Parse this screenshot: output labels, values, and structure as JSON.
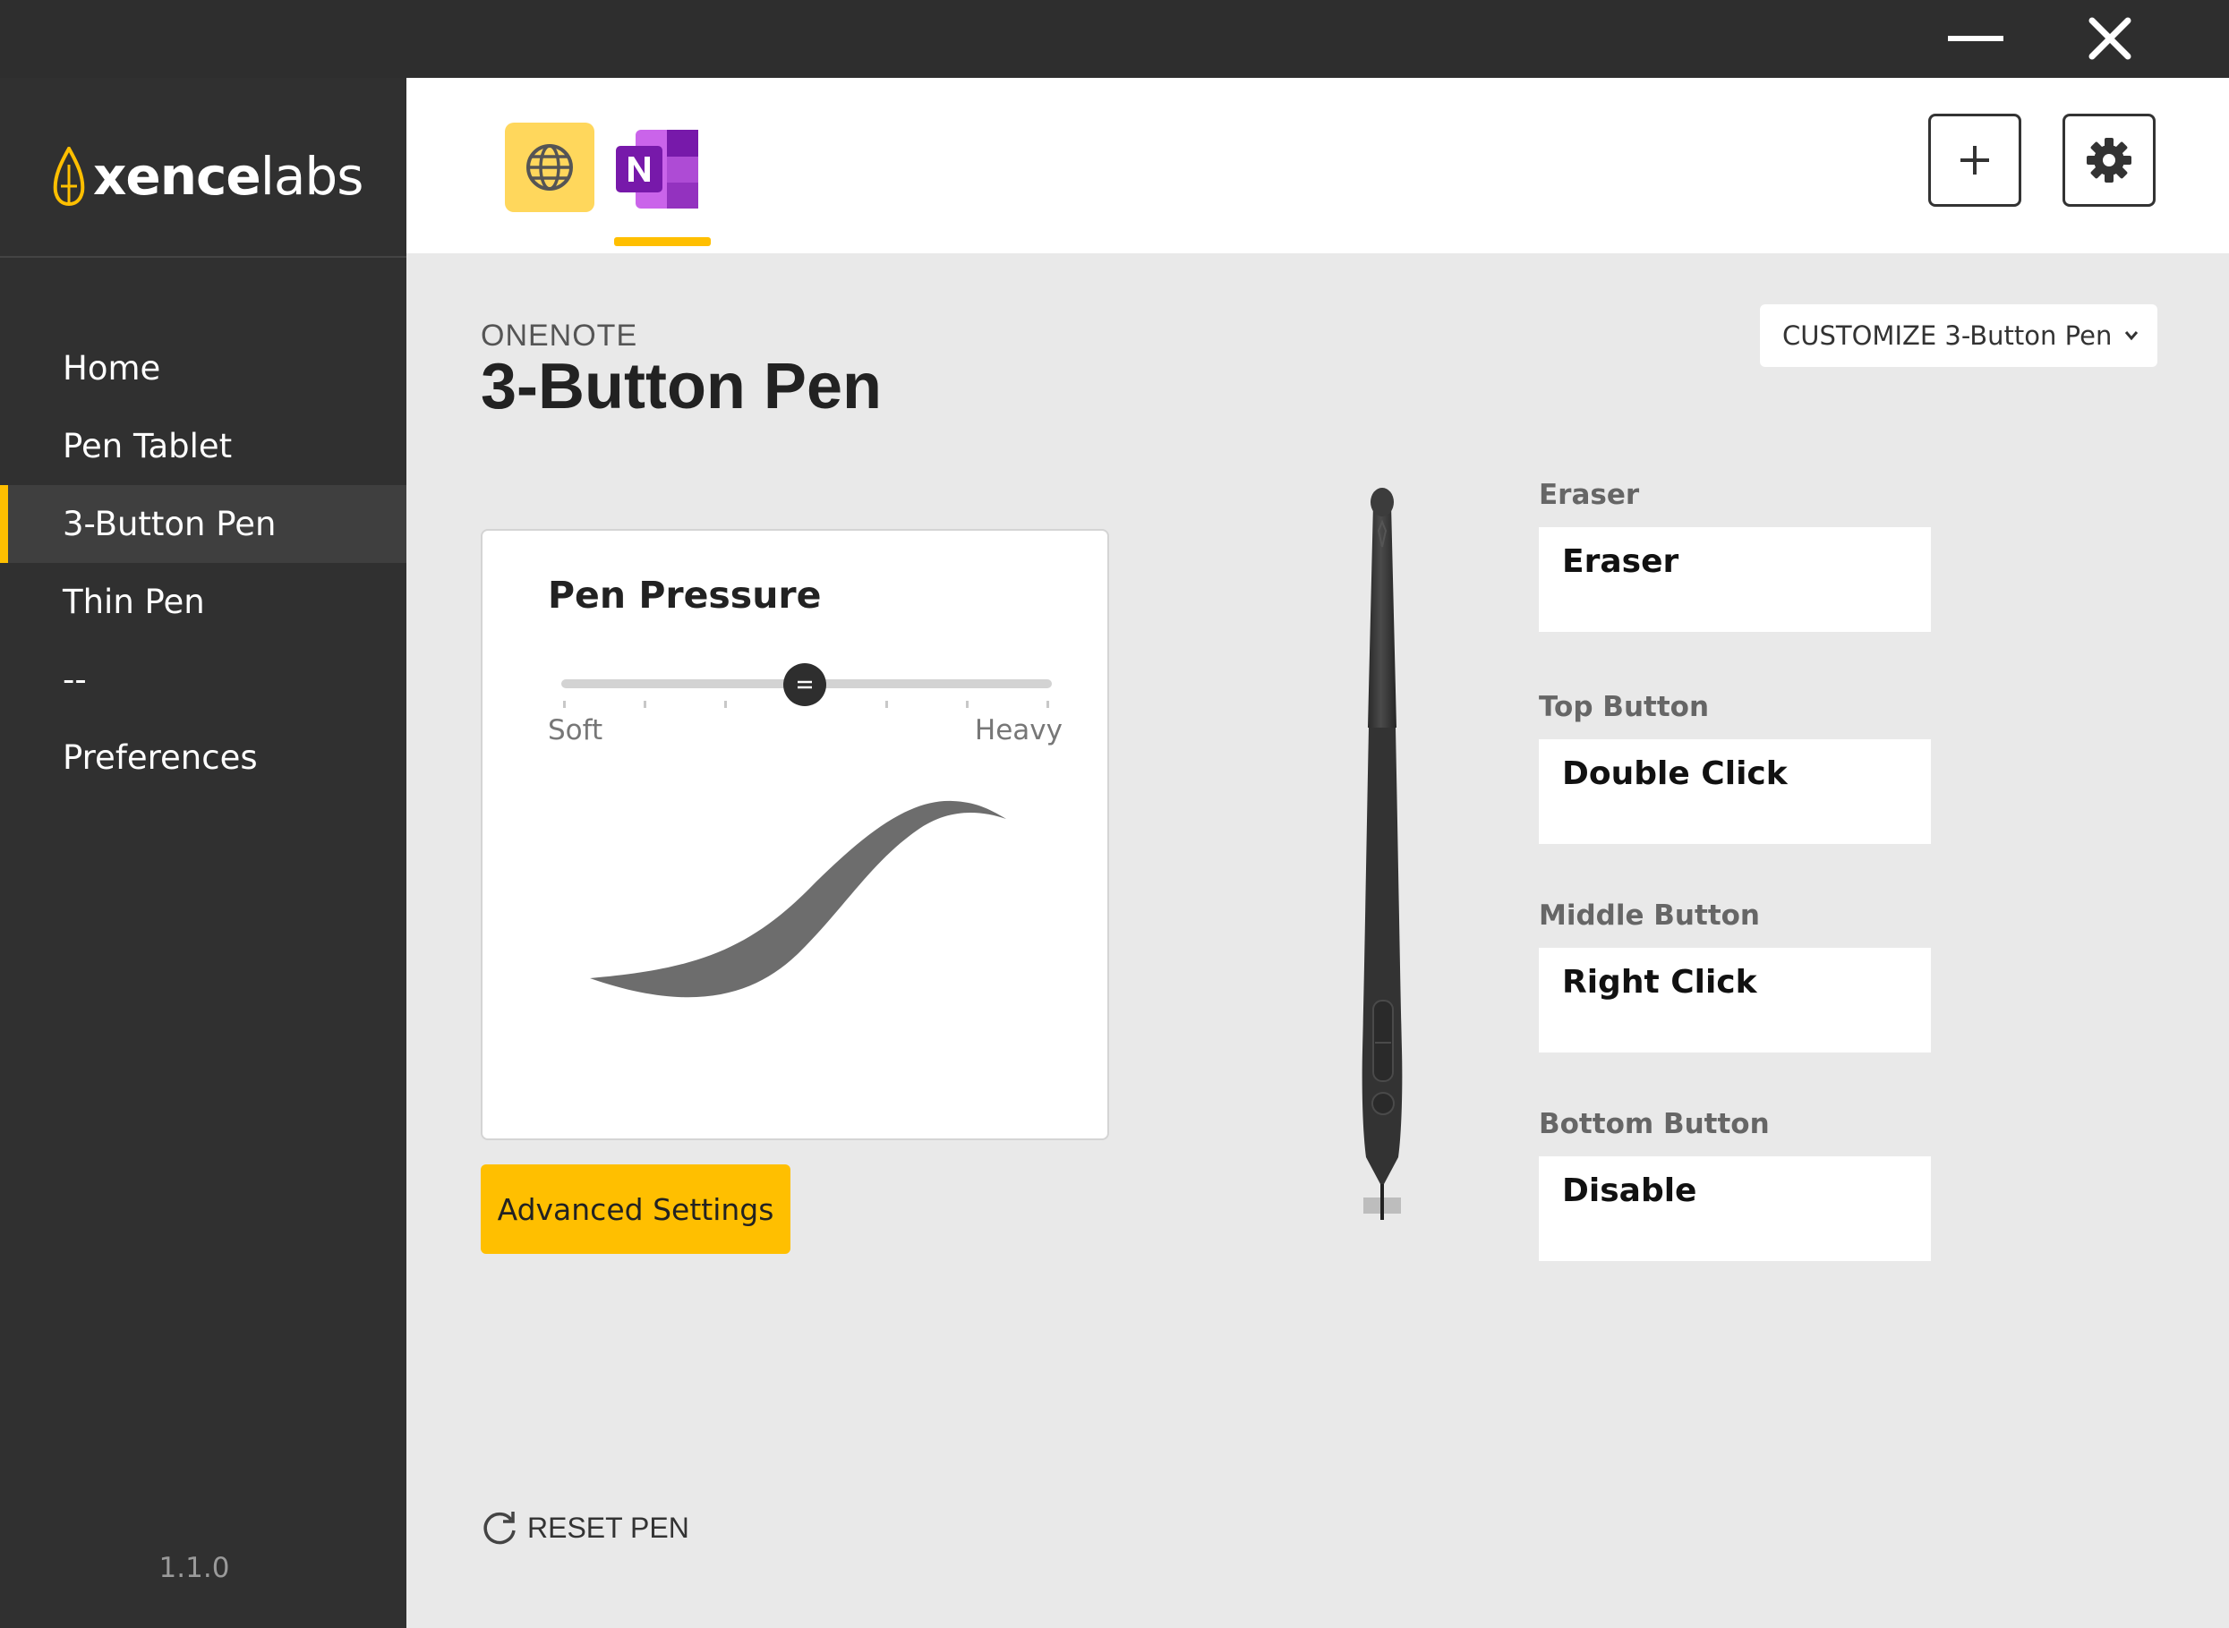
{
  "window": {
    "minimize_icon": "minimize-icon",
    "close_icon": "close-icon"
  },
  "brand": {
    "name_bold": "xence",
    "name_light": "labs",
    "logo_icon": "xencelabs-flame-icon",
    "accent": "#ffbf00"
  },
  "sidebar": {
    "items": [
      {
        "label": "Home"
      },
      {
        "label": "Pen Tablet"
      },
      {
        "label": "3-Button Pen",
        "active": true
      },
      {
        "label": "Thin Pen"
      },
      {
        "label": "--"
      },
      {
        "label": "Preferences"
      }
    ],
    "version": "1.1.0"
  },
  "apps": [
    {
      "name": "All Applications",
      "icon": "globe-icon"
    },
    {
      "name": "OneNote",
      "icon": "onenote-icon",
      "selected": true
    }
  ],
  "toolbar": {
    "add_icon": "plus-icon",
    "settings_icon": "gear-icon"
  },
  "main": {
    "app_label": "ONENOTE",
    "title": "3-Button Pen",
    "customize_label": "CUSTOMIZE 3-Button Pen"
  },
  "pressure": {
    "title": "Pen Pressure",
    "soft_label": "Soft",
    "heavy_label": "Heavy",
    "value": 0.5
  },
  "advanced_label": "Advanced Settings",
  "buttons": [
    {
      "label": "Eraser",
      "value": "Eraser"
    },
    {
      "label": "Top Button",
      "value": "Double Click"
    },
    {
      "label": "Middle Button",
      "value": "Right Click"
    },
    {
      "label": "Bottom Button",
      "value": "Disable"
    }
  ],
  "reset_label": "RESET PEN"
}
